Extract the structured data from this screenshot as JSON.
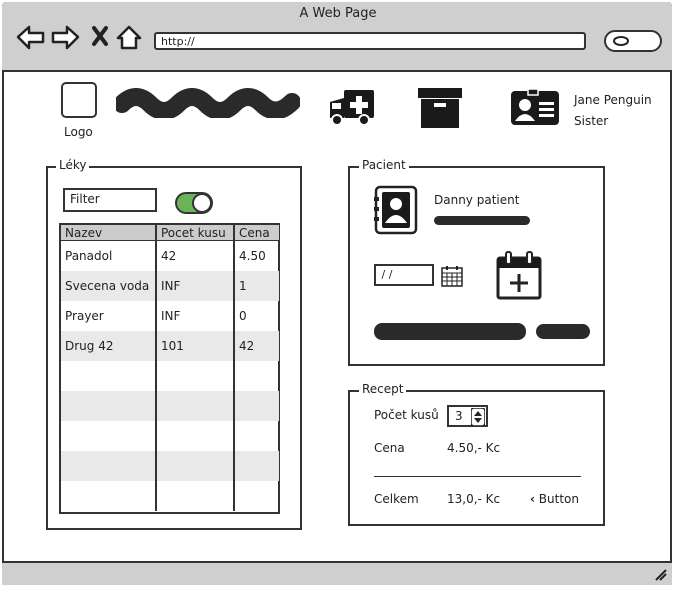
{
  "window": {
    "title": "A Web Page",
    "url": "http://"
  },
  "header": {
    "logo_label": "Logo",
    "user_name": "Jane Penguin",
    "user_role": "Sister"
  },
  "leky": {
    "legend": "Léky",
    "filter_value": "Filter",
    "toggle_on": true,
    "columns": [
      "Nazev",
      "Pocet kusu",
      "Cena"
    ],
    "rows": [
      [
        "Panadol",
        "42",
        "4.50"
      ],
      [
        "Svecena voda",
        "INF",
        "1"
      ],
      [
        "Prayer",
        "INF",
        "0"
      ],
      [
        "Drug 42",
        "101",
        "42"
      ]
    ]
  },
  "pacient": {
    "legend": "Pacient",
    "patient_name": "Danny patient",
    "date_value": " / /"
  },
  "recept": {
    "legend": "Recept",
    "pocet_label": "Počet kusů",
    "pocet_value": "3",
    "cena_label": "Cena",
    "cena_value": "4.50,- Kc",
    "celkem_label": "Celkem",
    "celkem_value": "13,0,- Kc",
    "button_label": "Button"
  }
}
